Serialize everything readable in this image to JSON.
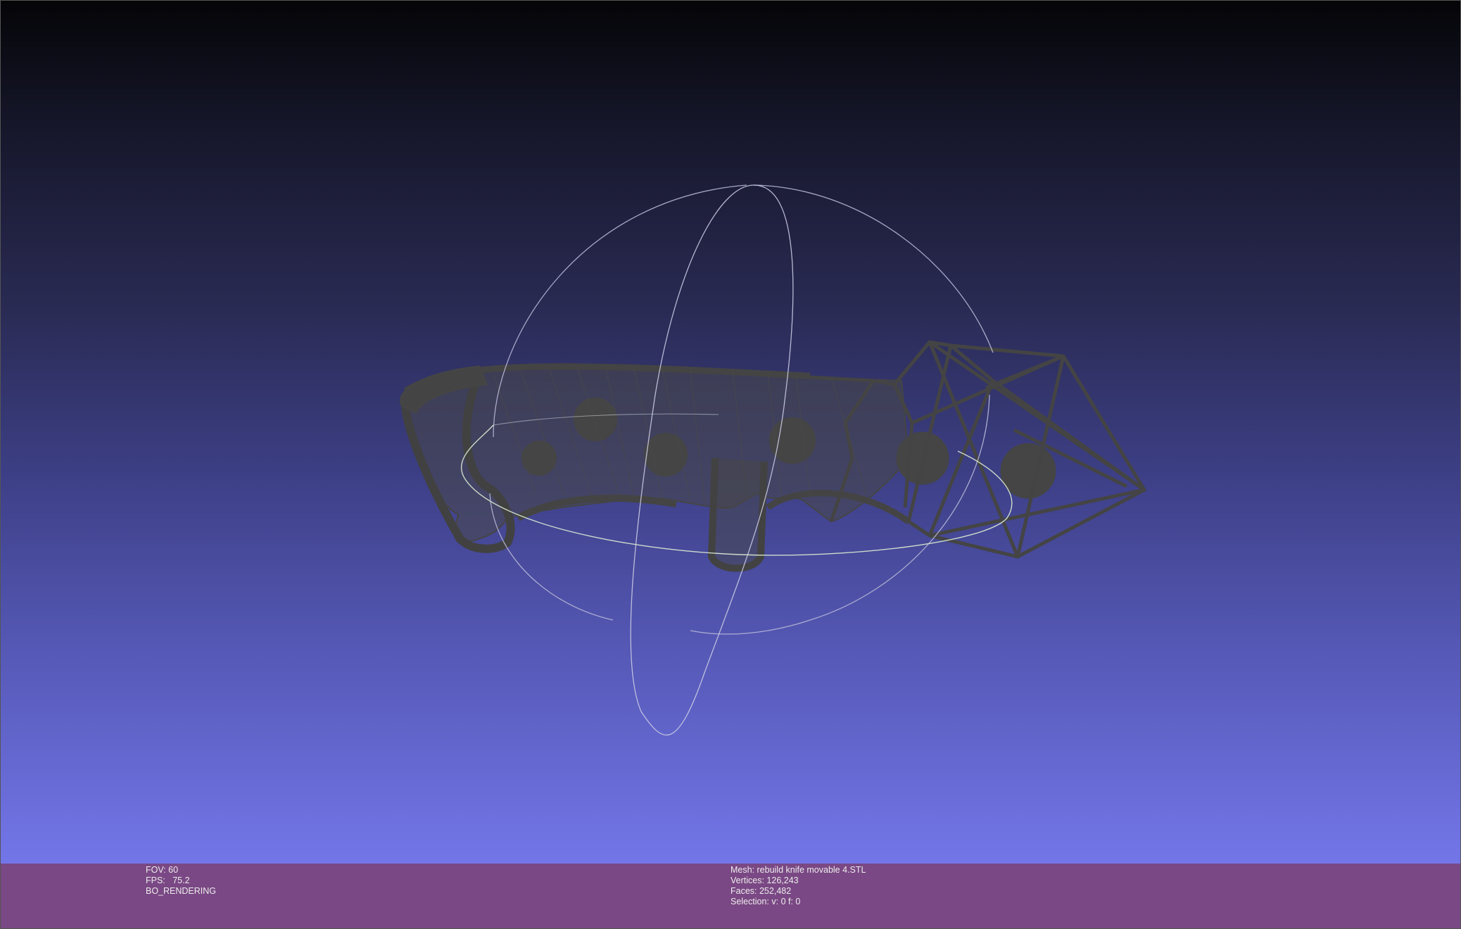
{
  "viewer": {
    "colors": {
      "background_top": "#050508",
      "background_bottom": "#7376e8",
      "mesh_wireframe": "#444444",
      "trackball_ring": "#c8c8dc",
      "info_bar": "#7a4884"
    },
    "trackball": "visible",
    "render_mode": "wireframe"
  },
  "info_left": {
    "fov": "FOV: 60",
    "fps": "FPS:   75.2",
    "mode": "BO_RENDERING"
  },
  "info_right": {
    "mesh": "Mesh: rebuild knife movable 4.STL",
    "vertices": "Vertices: 126,243",
    "faces": "Faces: 252,482",
    "selection": "Selection: v: 0 f: 0"
  }
}
